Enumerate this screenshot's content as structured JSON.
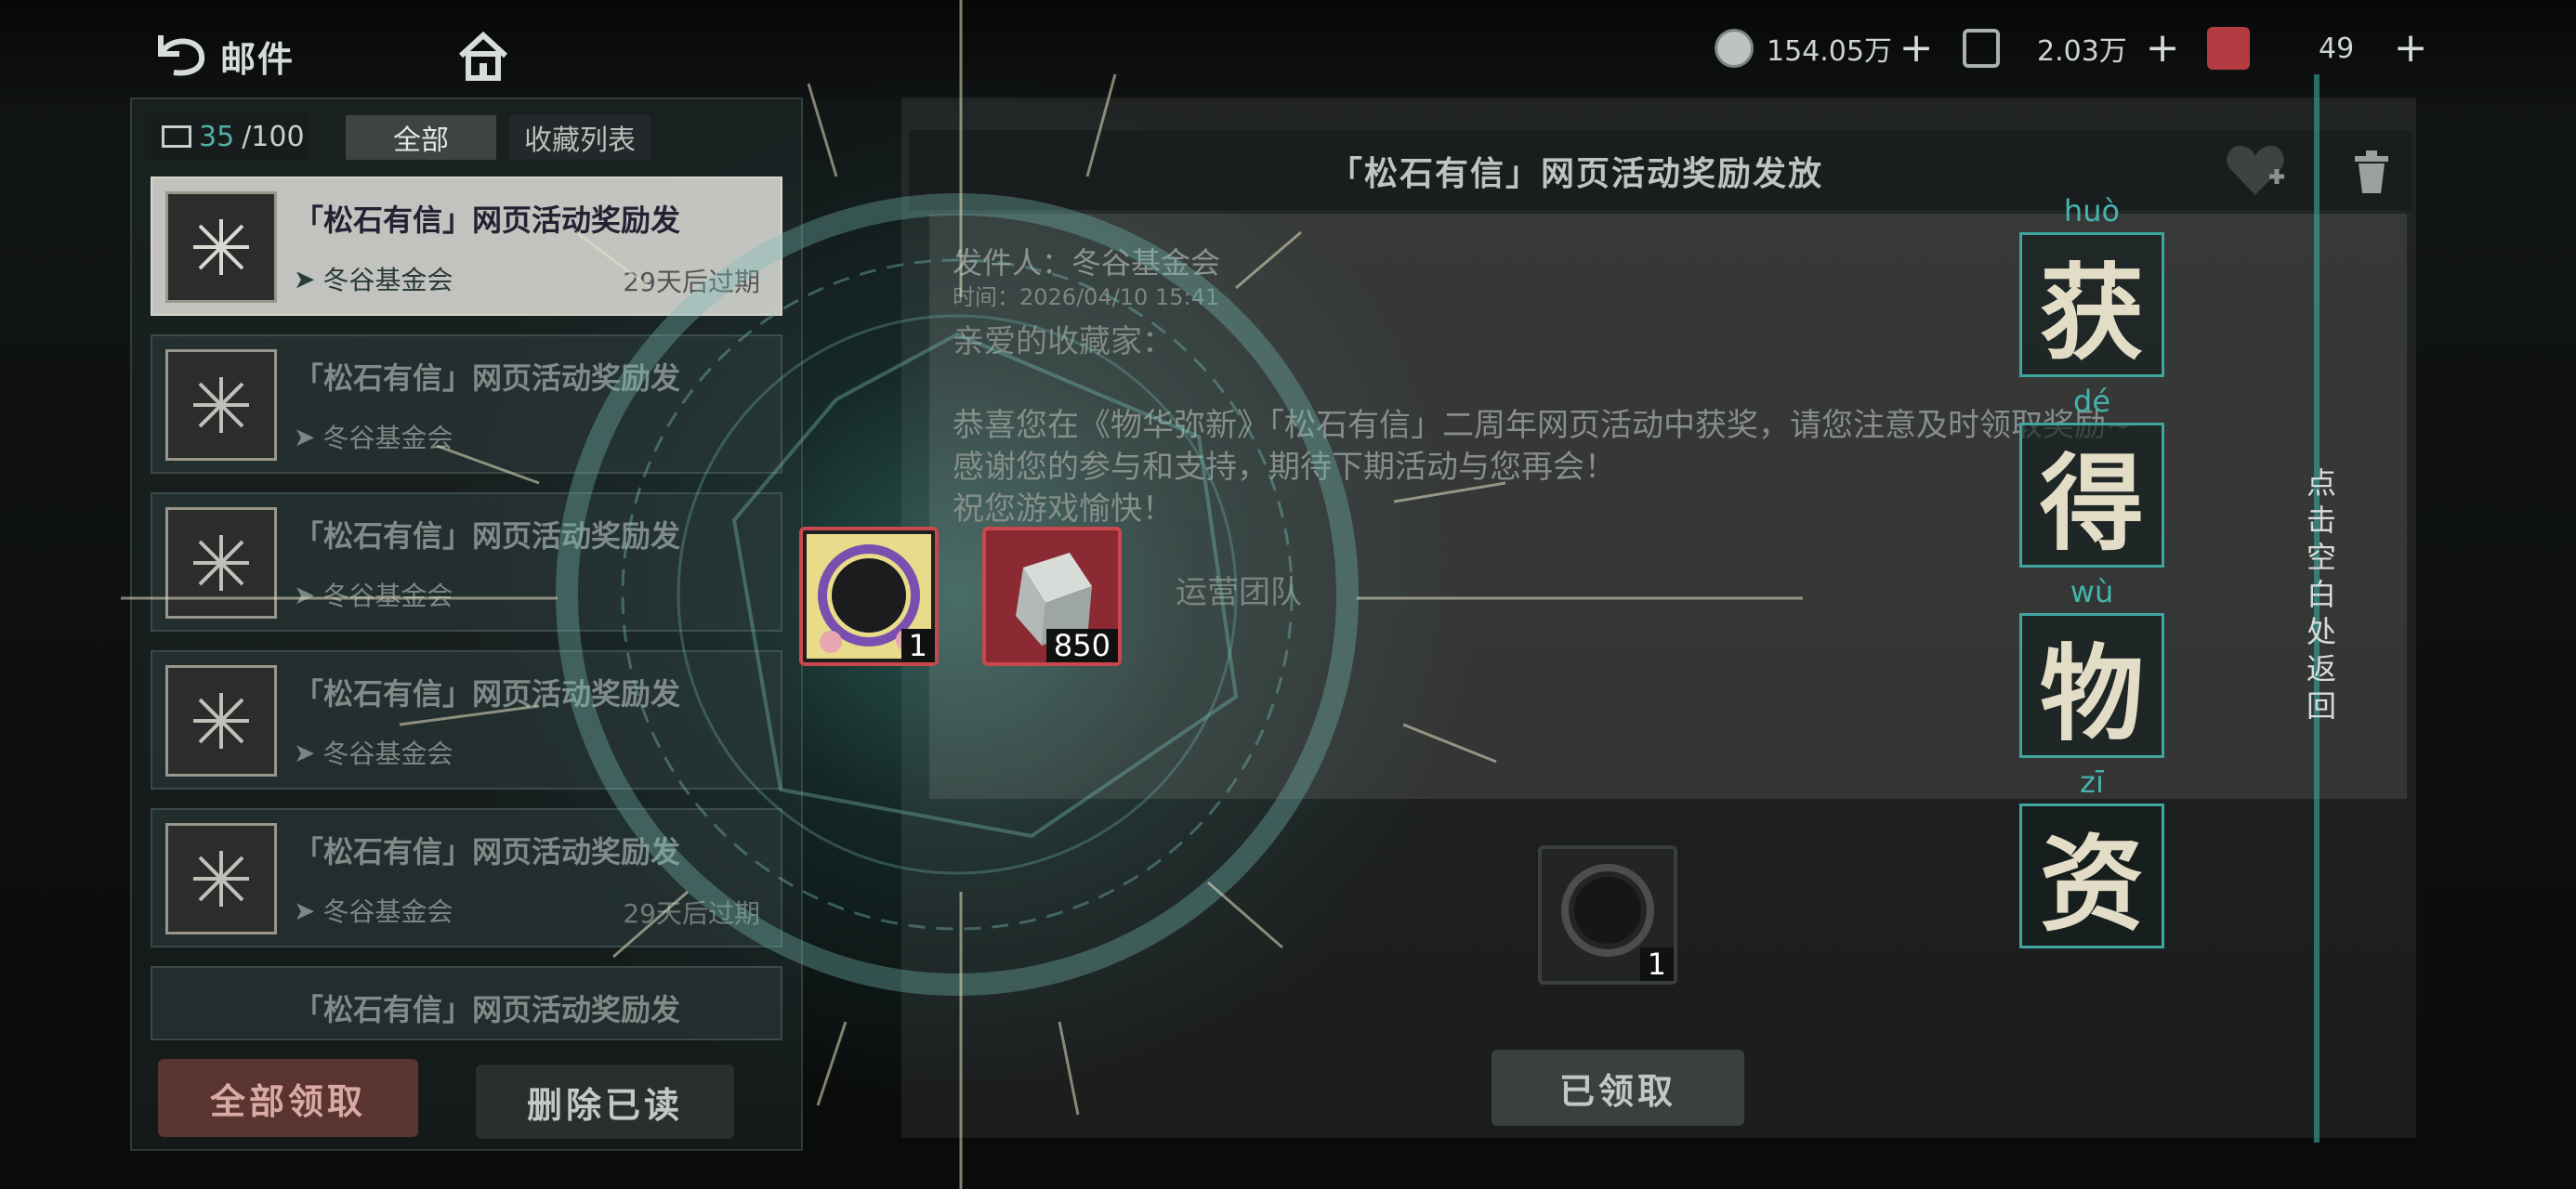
{
  "header": {
    "back_label": "邮件",
    "currencies": [
      {
        "icon": "coin-icon",
        "value": "154.05万"
      },
      {
        "icon": "card-icon",
        "value": "2.03万"
      },
      {
        "icon": "gem-icon",
        "value": "49"
      }
    ],
    "plus_label": "+"
  },
  "mailbox": {
    "count_current": "35",
    "count_total": "/100",
    "tabs": [
      {
        "label": "全部"
      },
      {
        "label": "收藏列表"
      }
    ],
    "items": [
      {
        "title": "「松石有信」网页活动奖励发",
        "sender": "冬谷基金会",
        "expire": "29天后过期"
      },
      {
        "title": "「松石有信」网页活动奖励发",
        "sender": "冬谷基金会",
        "expire": ""
      },
      {
        "title": "「松石有信」网页活动奖励发",
        "sender": "冬谷基金会",
        "expire": ""
      },
      {
        "title": "「松石有信」网页活动奖励发",
        "sender": "冬谷基金会",
        "expire": ""
      },
      {
        "title": "「松石有信」网页活动奖励发",
        "sender": "冬谷基金会",
        "expire": "29天后过期"
      },
      {
        "title": "「松石有信」网页活动奖励发",
        "sender": "",
        "expire": ""
      }
    ],
    "claim_all_label": "全部领取",
    "delete_read_label": "删除已读"
  },
  "detail": {
    "title": "「松石有信」网页活动奖励发放",
    "sender": "发件人：冬谷基金会",
    "time": "时间：2026/04/10 15:41",
    "greeting": "亲爱的收藏家：",
    "body_line1": "恭喜您在《物华弥新》「松石有信」二周年网页活动中获奖，请您注意及时领取奖励~",
    "body_line2": "感谢您的参与和支持，期待下期活动与您再会！",
    "body_line3": "祝您游戏愉快！",
    "signature": "运营团队",
    "attachment_qty": "1",
    "claimed_label": "已领取"
  },
  "rewards": {
    "heading_chars": [
      {
        "char": "获",
        "pinyin": "huò"
      },
      {
        "char": "得",
        "pinyin": "dé"
      },
      {
        "char": "物",
        "pinyin": "wù"
      },
      {
        "char": "资",
        "pinyin": "zī"
      }
    ],
    "items": [
      {
        "icon": "frame-icon",
        "qty": "1"
      },
      {
        "icon": "crystal-cube-icon",
        "qty": "850"
      }
    ],
    "hint": "点击空白处返回"
  },
  "colors": {
    "accent": "#3fa59f",
    "claim_all_bg": "#5a3431",
    "reward_border": "#c9484d"
  }
}
